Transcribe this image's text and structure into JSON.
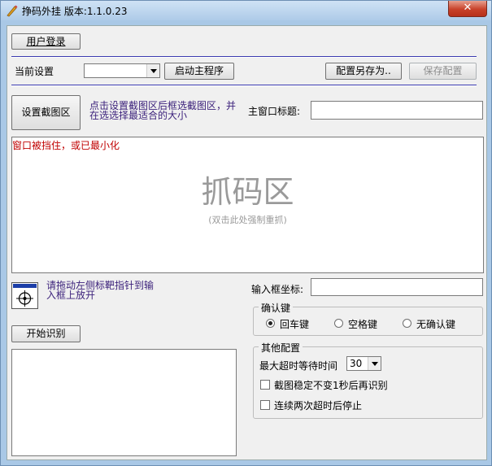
{
  "window": {
    "title": "挣码外挂 版本:1.1.0.23",
    "close_label": "✕"
  },
  "login_button": "用户登录",
  "settings": {
    "current_label": "当前设置",
    "current_value": "",
    "start_main_button": "启动主程序",
    "save_as_button": "配置另存为..",
    "save_button": "保存配置"
  },
  "capture": {
    "set_area_button": "设置截图区",
    "hint": "点击设置截图区后框选截图区，并在选选择最适合的大小",
    "main_title_label": "主窗口标题:",
    "main_title_value": "",
    "status_text": "窗口被挡住，或已最小化",
    "area_title": "抓码区",
    "area_subtitle": "(双击此处强制重抓)"
  },
  "target": {
    "drag_hint": "请拖动左侧标靶指针到输入框上放开",
    "input_coords_label": "输入框坐标:",
    "input_coords_value": ""
  },
  "start_recognition_button": "开始识别",
  "confirm_key": {
    "legend": "确认键",
    "options": [
      "回车键",
      "空格键",
      "无确认键"
    ],
    "selected": "回车键"
  },
  "other": {
    "legend": "其他配置",
    "max_timeout_label": "最大超时等待时间",
    "max_timeout_value": "30",
    "option_stable": "截图稳定不变1秒后再识别",
    "option_stop": "连续两次超时后停止"
  },
  "colors": {
    "status_text": "#c00000",
    "hint_text": "#3a1f7a",
    "area_watermark": "#9a9a9a"
  }
}
